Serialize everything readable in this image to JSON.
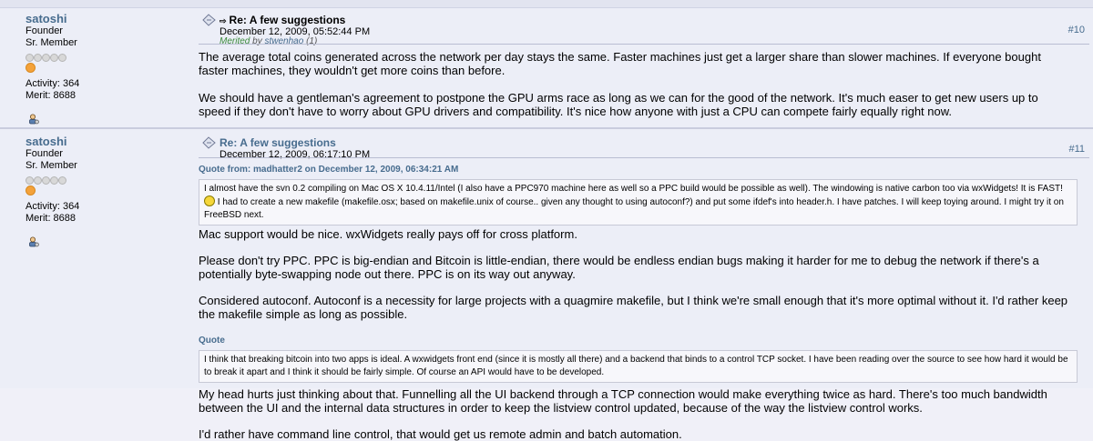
{
  "top_strip": "· · · · · · · · · · · · · · · · · · · · · · · · · · · · · · · · · · · · · · · · ·",
  "posts": [
    {
      "username": "satoshi",
      "rank1": "Founder",
      "rank2": "Sr. Member",
      "activity": "Activity: 364",
      "merit": "Merit: 8688",
      "subject": "Re: A few suggestions",
      "date": "December 12, 2009, 05:52:44 PM",
      "merited_prefix": "Merited",
      "merited_by": "by",
      "merited_user": "stwenhao",
      "merited_count": "(1)",
      "post_number": "#10",
      "paragraphs": [
        "The average total coins generated across the network per day stays the same.  Faster machines just get a larger share than slower machines.  If everyone bought faster machines, they wouldn't get more coins than before.",
        "We should have a gentleman's agreement to postpone the GPU arms race as long as we can for the good of the network.  It's much easer to get new users up to speed if they don't have to worry about GPU drivers and compatibility.  It's nice how anyone with just a CPU can compete fairly equally right now."
      ]
    },
    {
      "username": "satoshi",
      "rank1": "Founder",
      "rank2": "Sr. Member",
      "activity": "Activity: 364",
      "merit": "Merit: 8688",
      "subject": "Re: A few suggestions",
      "date": "December 12, 2009, 06:17:10 PM",
      "post_number": "#11",
      "quote1_header": "Quote from: madhatter2 on December 12, 2009, 06:34:21 AM",
      "quote1_text_a": "I almost have the svn 0.2 compiling on Mac OS X 10.4.11/Intel (I also have a PPC970 machine here as well so a PPC build would be possible as well). The windowing is native carbon too via wxWidgets! It is FAST!",
      "quote1_text_b": "I had to create a new makefile (makefile.osx; based on makefile.unix of course.. given any thought to using autoconf?) and put some ifdef's into header.h. I have patches. I will keep toying around. I might try it on FreeBSD next.",
      "para1": "Mac support would be nice.  wxWidgets really pays off for cross platform.",
      "para2": "Please don't try PPC.  PPC is big-endian and Bitcoin is little-endian, there would be endless endian bugs making it harder for me to debug the network if there's a potentially byte-swapping node out there.  PPC is on its way out anyway.",
      "para3": "Considered autoconf.  Autoconf is a necessity for large projects with a quagmire makefile, but I think we're small enough that it's more optimal without it.  I'd rather keep the makefile simple as long as possible.",
      "quote2_header": "Quote",
      "quote2_text": "I think that breaking bitcoin into two apps is ideal. A wxwidgets front end (since it is mostly all there) and a backend that binds to a control TCP socket. I have been reading over the source to see how hard it would be to break it apart and I think it should be fairly simple. Of course an API would have to be developed.",
      "para4": "My head hurts just thinking about that.  Funnelling all the UI backend through a TCP connection would make everything twice as hard.  There's too much bandwidth between the UI and the internal data structures in order to keep the listview control updated, because of the way the listview control works.",
      "para5": "I'd rather have command line control, that would get us remote admin and batch automation."
    }
  ],
  "icons": {
    "message": "message-icon",
    "profile": "profile-icon",
    "star": "star-icon",
    "badge": "founder-badge-icon",
    "smiley": "smiley-icon"
  },
  "colors": {
    "username": "#476c8e",
    "background": "#eceef7",
    "separator": "#b9bdd2"
  }
}
